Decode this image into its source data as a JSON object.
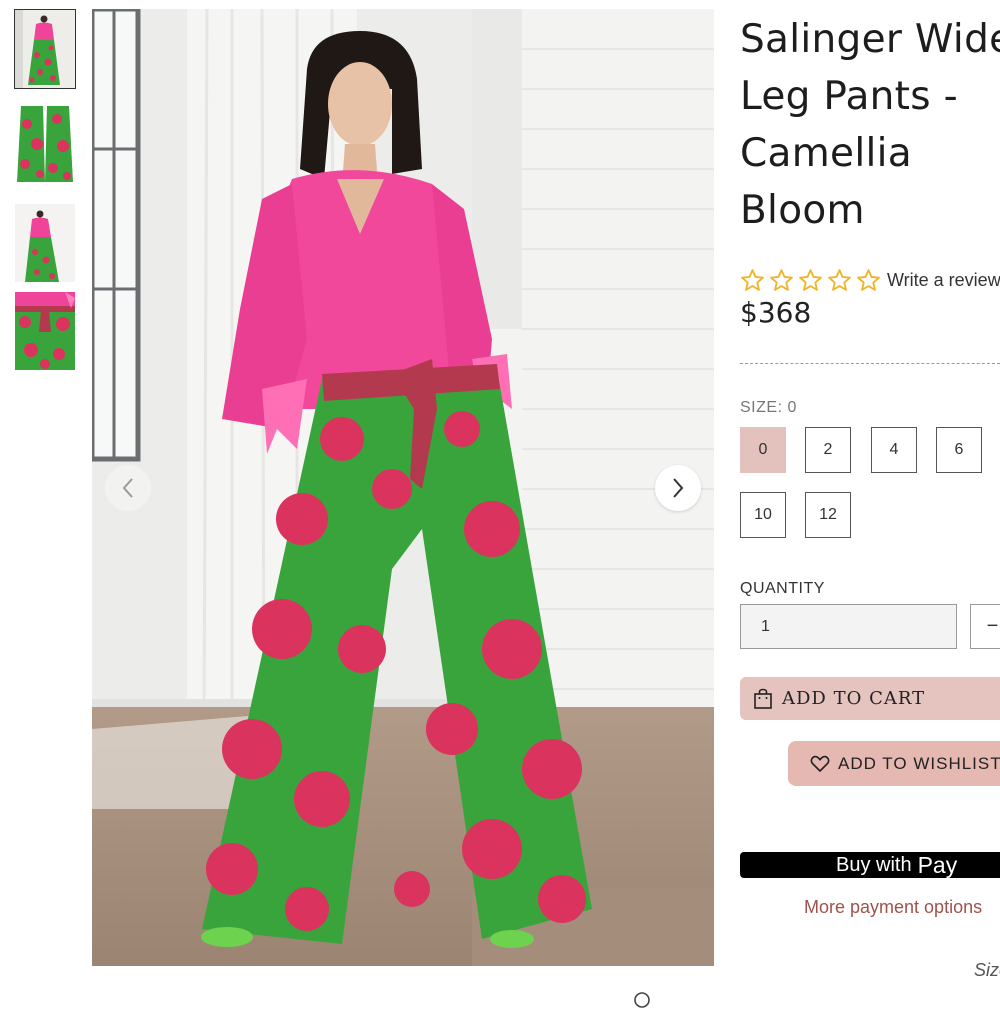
{
  "product": {
    "title_lines": [
      "Salinger Wide",
      "Leg Pants -",
      "Camellia",
      "Bloom"
    ],
    "rating_stars": 0,
    "rating_max": 5,
    "write_review": "Write a review",
    "price": "$368"
  },
  "gallery": {
    "thumbnails": [
      {
        "name": "full-outfit-front"
      },
      {
        "name": "pants-flat"
      },
      {
        "name": "full-outfit-side"
      },
      {
        "name": "waist-detail"
      }
    ],
    "active_index": 0,
    "prev_icon": "chevron-left-icon",
    "next_icon": "chevron-right-icon"
  },
  "size": {
    "label": "SIZE: 0",
    "options": [
      "0",
      "2",
      "4",
      "6",
      "10",
      "12"
    ],
    "selected": "0"
  },
  "quantity": {
    "label": "QUANTITY",
    "value": "1",
    "minus": "−"
  },
  "actions": {
    "add_to_cart": "ADD TO CART",
    "add_to_wishlist": "ADD TO WISHLIST",
    "apple_pay_buy": "Buy with",
    "apple_pay_symbol": "",
    "apple_pay_pay": "Pay",
    "more_payment": "More payment options"
  },
  "size_guide": "Size guide",
  "colors": {
    "accent_pink": "#e5c3bf",
    "wishlist_pink": "#e5b8b1",
    "link_red": "#a0524b",
    "shirt_pink": "#f1489c",
    "pants_green": "#3aa43c",
    "pants_flower": "#d9335e"
  }
}
